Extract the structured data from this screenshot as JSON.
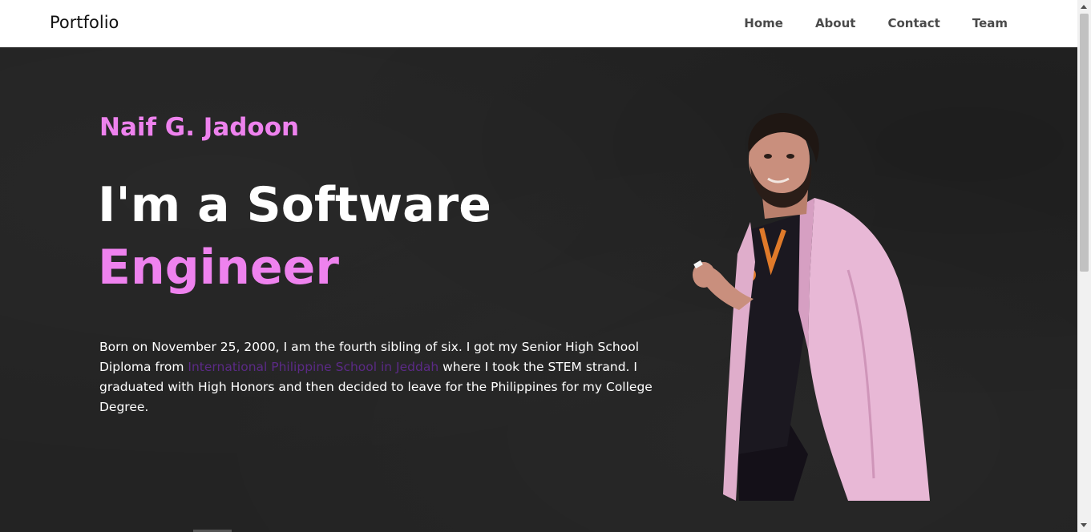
{
  "nav": {
    "brand": "Portfolio",
    "links": [
      "Home",
      "About",
      "Contact",
      "Team"
    ]
  },
  "hero": {
    "name": "Naif G. Jadoon",
    "headline_line1": "I'm a Software",
    "headline_line2": "Engineer",
    "bio_before": "Born on November 25, 2000, I am the fourth sibling of six. I got my Senior High School Diploma from ",
    "bio_link": "International Philippine School in Jeddah",
    "bio_after": " where I took the STEM strand. I graduated with High Honors and then decided to leave for the Philippines for my College Degree."
  },
  "colors": {
    "accent": "#ee82ee",
    "link": "#5b2a86",
    "background": "#232323",
    "jacket": "#e8b8d6"
  }
}
